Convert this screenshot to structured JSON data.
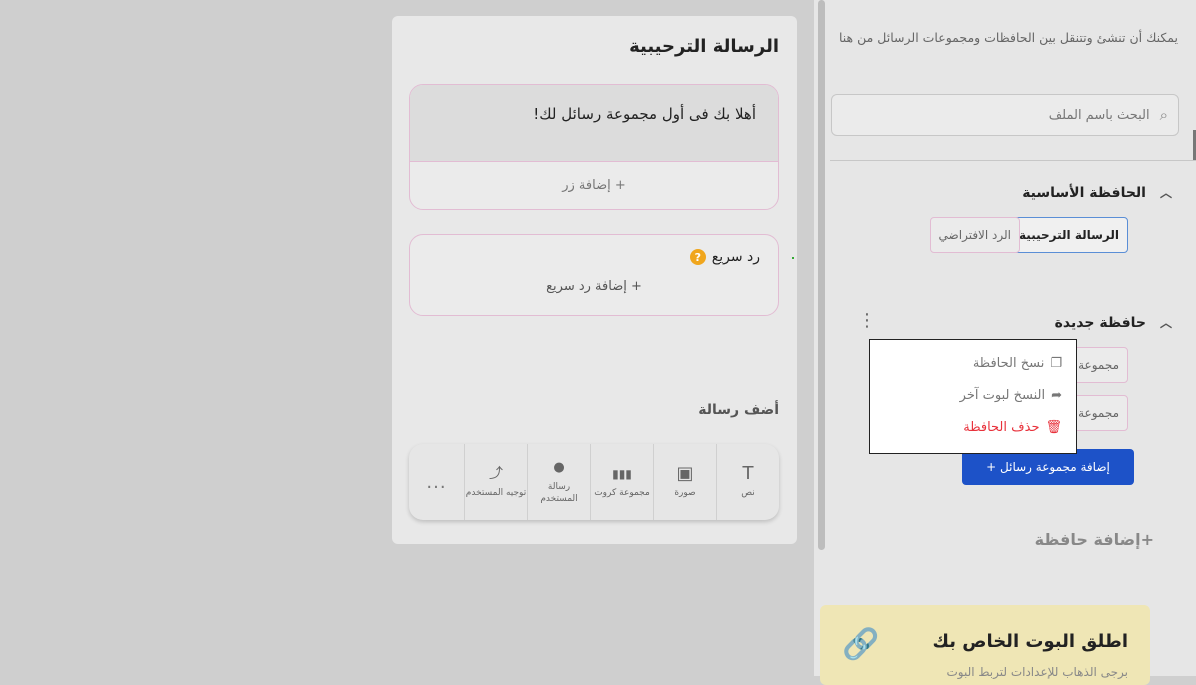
{
  "welcome": {
    "title": "الرسالة الترحيبية",
    "message_text": "أهلا بك فى أول مجموعة رسائل لك!",
    "add_button_label": "+ إضافة زر",
    "quick_reply_title": "رد سريع",
    "quick_reply_help": "?",
    "add_quick_reply_label": "+ إضافة رد سريع",
    "add_message_title": "أضف رسالة",
    "tools": [
      {
        "icon": "text-icon",
        "glyph": "T",
        "label": "نص"
      },
      {
        "icon": "image-icon",
        "glyph": "▣",
        "label": "صورة"
      },
      {
        "icon": "cards-icon",
        "glyph": "▮▮▮",
        "label": "مجموعة كروت"
      },
      {
        "icon": "user-message-icon",
        "glyph": "●",
        "label": "رسالة المستخدم"
      },
      {
        "icon": "redirect-icon",
        "glyph": "⤴",
        "label": "توجيه المستخدم"
      }
    ],
    "more_label": "..."
  },
  "sidebar": {
    "intro": "يمكنك أن تنشئ وتتنقل بين الحافظات ومجموعات الرسائل من هنا",
    "search_placeholder": "البحث باسم الملف",
    "main_folder": {
      "title": "الحافظة الأساسية",
      "chips": [
        "الرسالة الترحيبية",
        "الرد الافتراضي"
      ]
    },
    "new_folder": {
      "title": "حافظة جديدة",
      "chips": [
        "مجموعة",
        "مجموعة"
      ]
    },
    "add_group_button": "إضافة مجموعة رسائل +",
    "add_folder_label": "+إضافة حافظة",
    "promo": {
      "title": "اطلق البوت الخاص بك",
      "subtitle": "برجى الذهاب للإعدادات لتربط البوت"
    }
  },
  "context_menu": {
    "copy_folder": "نسخ الحافظة",
    "copy_to_bot": "النسخ لبوت آخر",
    "delete_folder": "حذف الحافظة"
  },
  "colors": {
    "accent_blue": "#1d52c8",
    "danger_red": "#e8323c",
    "help_orange": "#f0a61d"
  }
}
